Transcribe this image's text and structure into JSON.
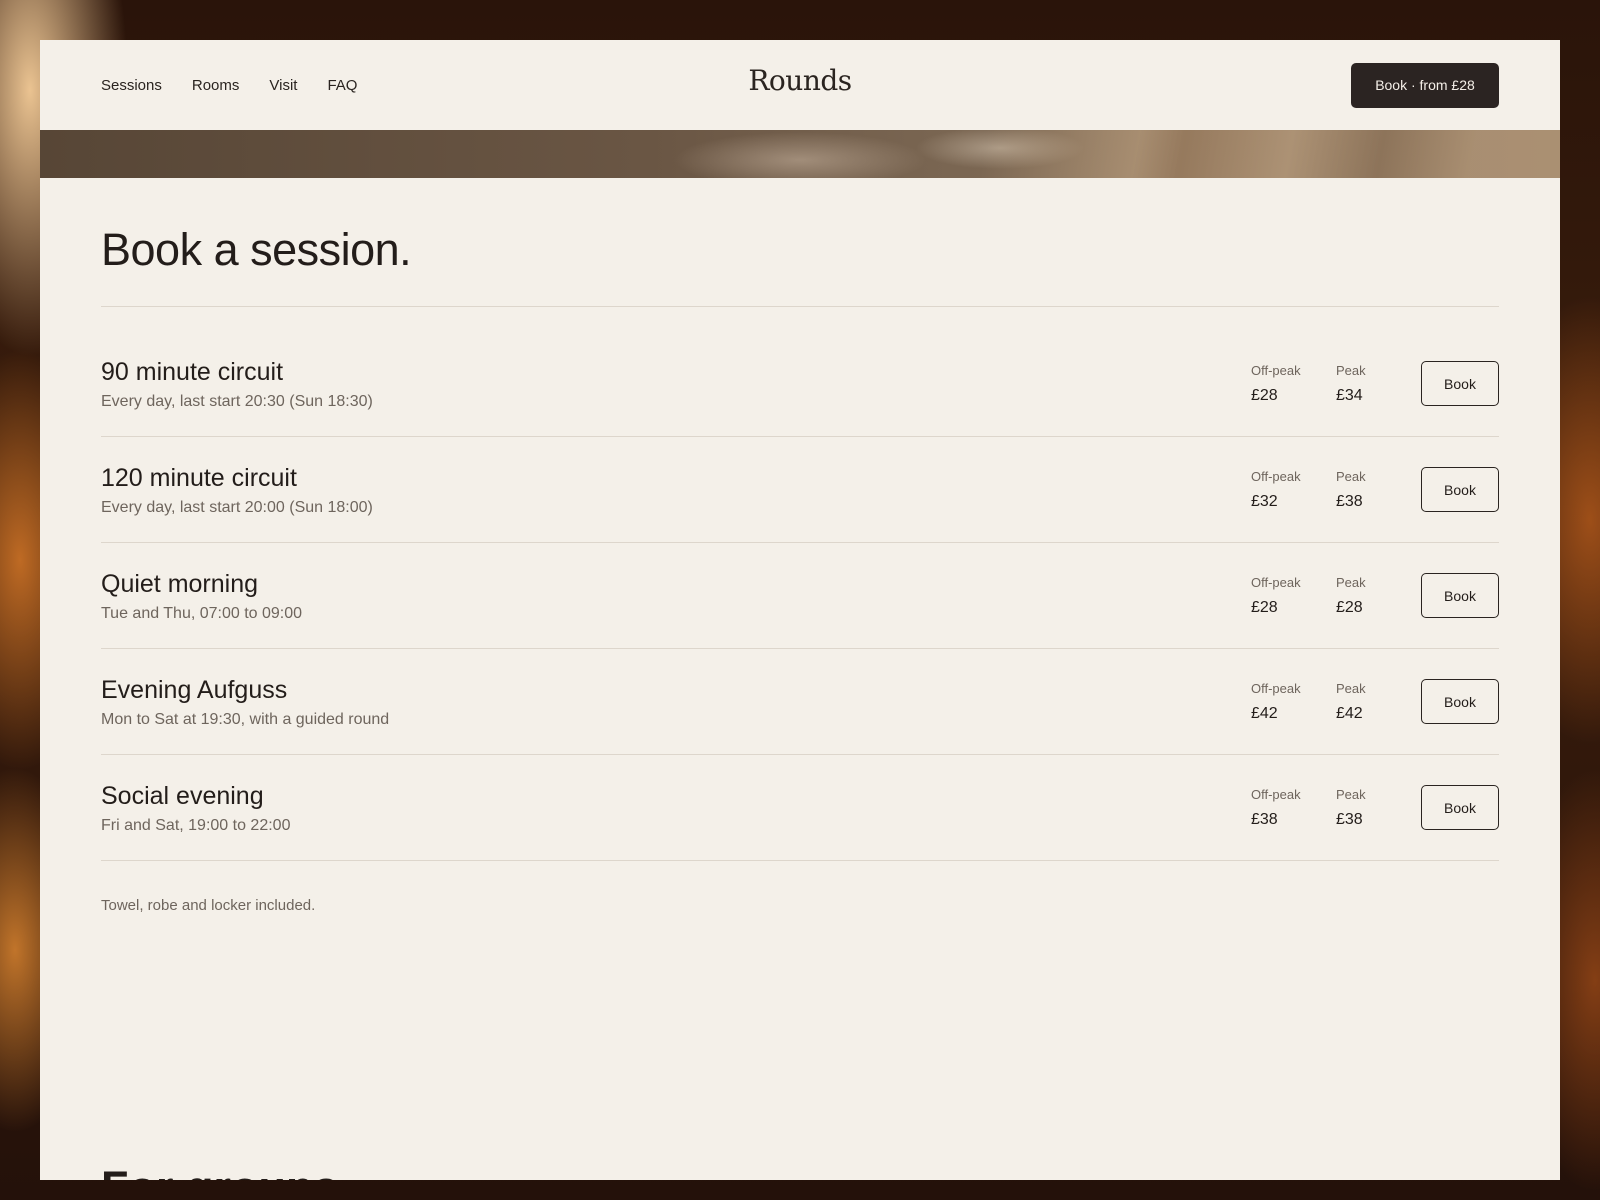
{
  "header": {
    "nav": [
      "Sessions",
      "Rooms",
      "Visit",
      "FAQ"
    ],
    "brand": "Rounds",
    "cta_label": "Book · from £28"
  },
  "main": {
    "title": "Book a session.",
    "sessions": [
      {
        "name": "90 minute circuit",
        "schedule": "Every day, last start 20:30 (Sun 18:30)",
        "offpeak_label": "Off-peak",
        "offpeak": "£28",
        "peak_label": "Peak",
        "peak": "£34",
        "button": "Book"
      },
      {
        "name": "120 minute circuit",
        "schedule": "Every day, last start 20:00 (Sun 18:00)",
        "offpeak_label": "Off-peak",
        "offpeak": "£32",
        "peak_label": "Peak",
        "peak": "£38",
        "button": "Book"
      },
      {
        "name": "Quiet morning",
        "schedule": "Tue and Thu, 07:00 to 09:00",
        "offpeak_label": "Off-peak",
        "offpeak": "£28",
        "peak_label": "Peak",
        "peak": "£28",
        "button": "Book"
      },
      {
        "name": "Evening Aufguss",
        "schedule": "Mon to Sat at 19:30, with a guided round",
        "offpeak_label": "Off-peak",
        "offpeak": "£42",
        "peak_label": "Peak",
        "peak": "£42",
        "button": "Book"
      },
      {
        "name": "Social evening",
        "schedule": "Fri and Sat, 19:00 to 22:00",
        "offpeak_label": "Off-peak",
        "offpeak": "£38",
        "peak_label": "Peak",
        "peak": "£38",
        "button": "Book"
      }
    ],
    "note": "Towel, robe and locker included.",
    "next_heading": "For groups"
  },
  "colors": {
    "page_bg": "#f4f0e9",
    "text": "#231d1a",
    "muted": "#6e655d",
    "cta_bg": "#2b2422",
    "rule": "#ddd6cc"
  }
}
